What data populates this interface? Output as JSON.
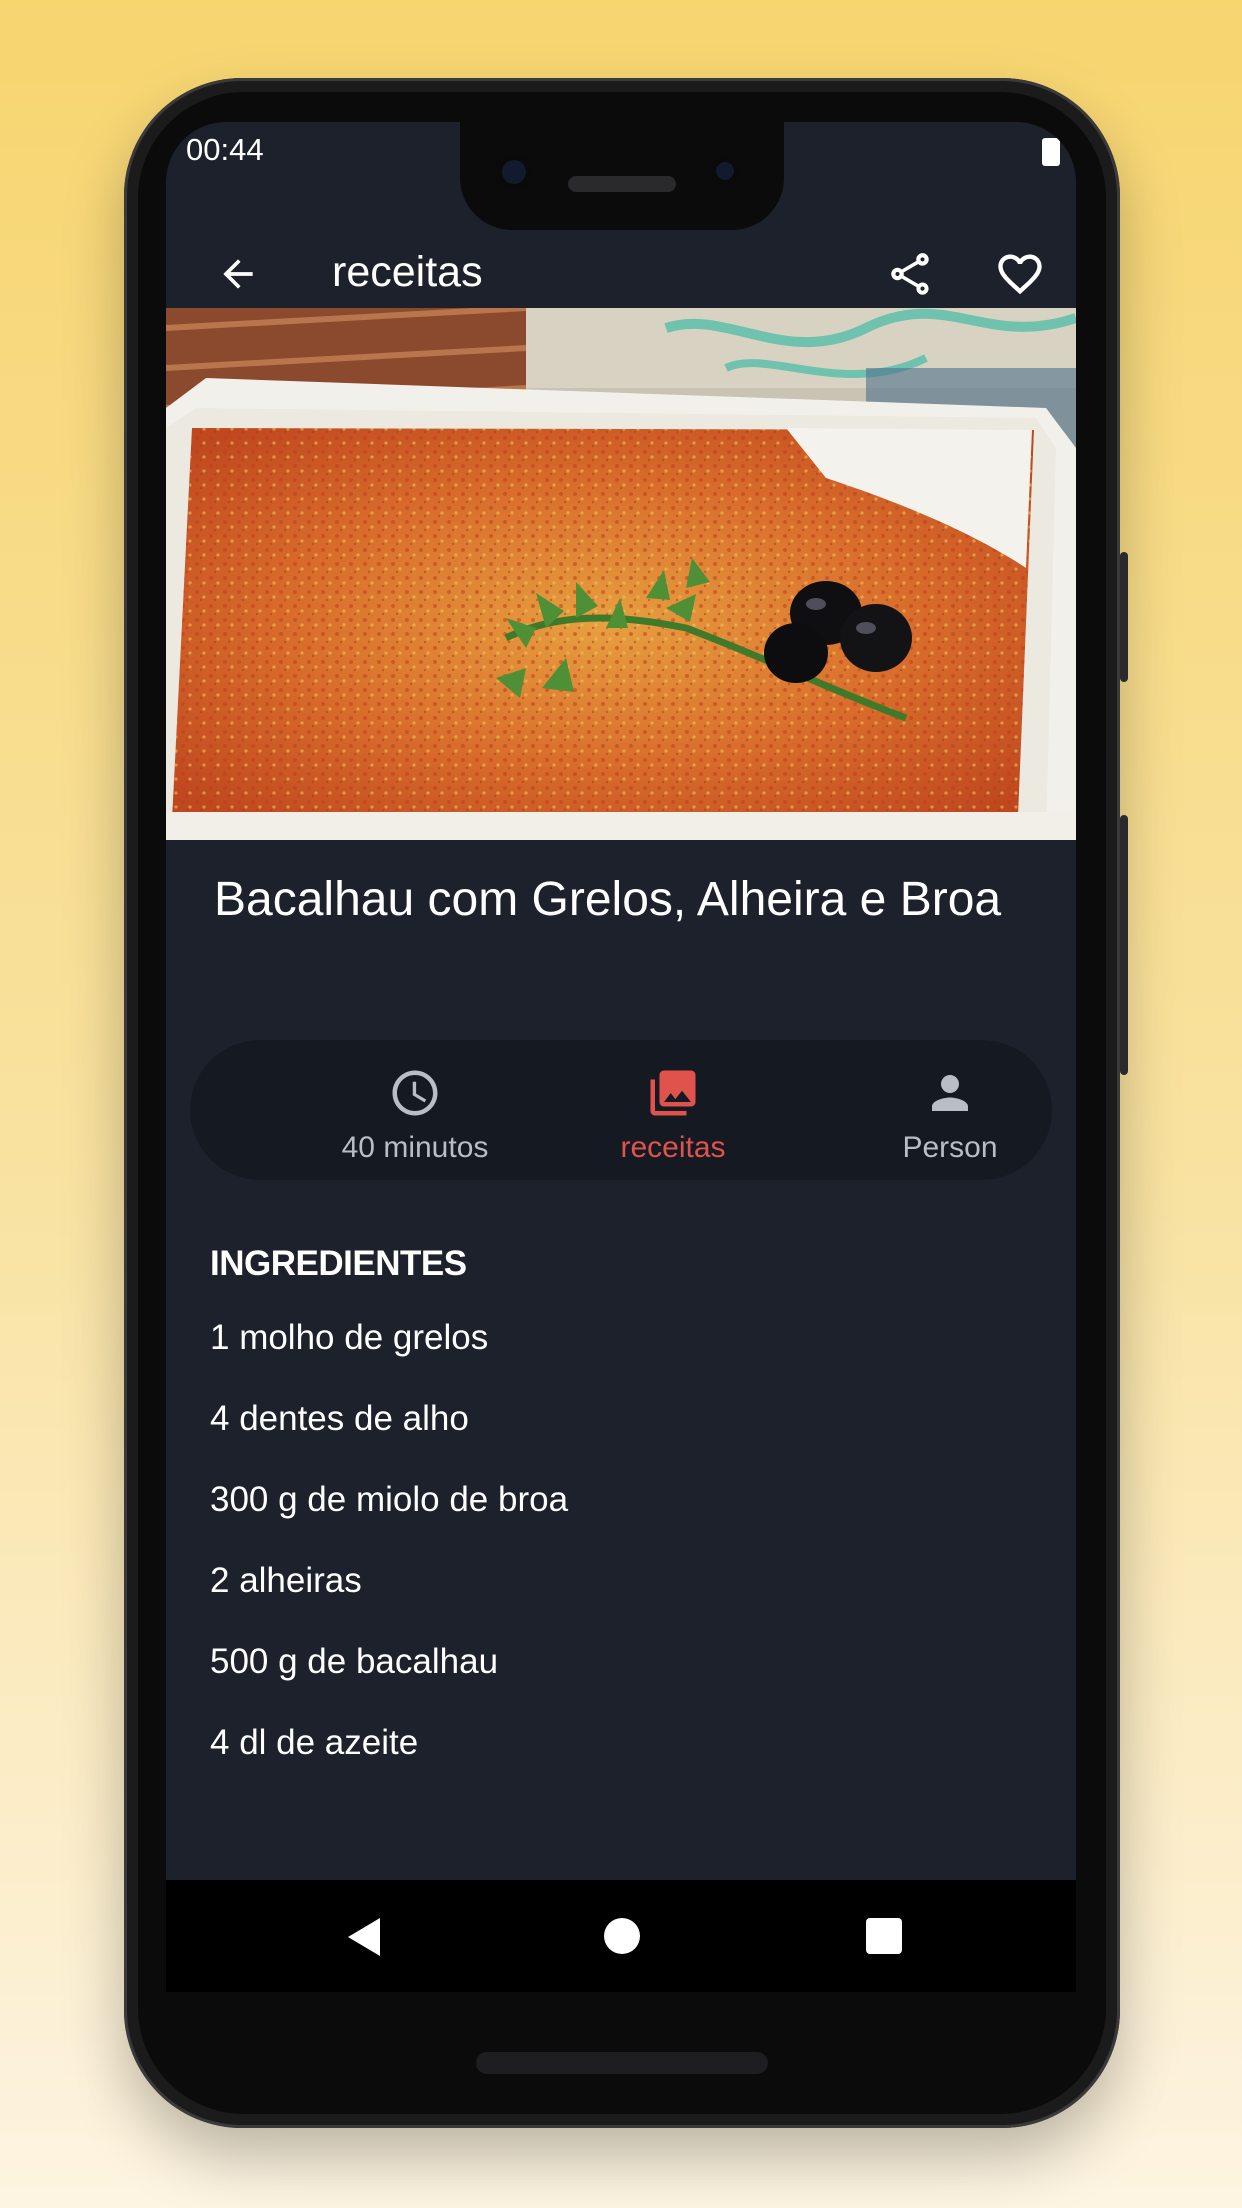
{
  "status_bar": {
    "time": "00:44"
  },
  "app_bar": {
    "title": "receitas"
  },
  "recipe": {
    "title": "Bacalhau com Grelos, Alheira e Broa"
  },
  "info": {
    "time_label": "40 minutos",
    "recipes_label": "receitas",
    "person_label": "Person"
  },
  "ingredients": {
    "heading": "INGREDIENTES",
    "items": [
      "1 molho de grelos",
      "4 dentes de alho",
      "300 g de miolo de broa",
      "2 alheiras",
      "500 g de bacalhau",
      "4 dl de azeite"
    ]
  },
  "icons": {
    "back": "arrow-back-icon",
    "share": "share-icon",
    "favorite": "heart-outline-icon",
    "time": "clock-icon",
    "recipes": "photo-library-icon",
    "person": "person-icon"
  },
  "colors": {
    "background": "#1c212b",
    "info_bar": "#151a22",
    "accent": "#e0534c",
    "muted": "#b9bdc6"
  }
}
